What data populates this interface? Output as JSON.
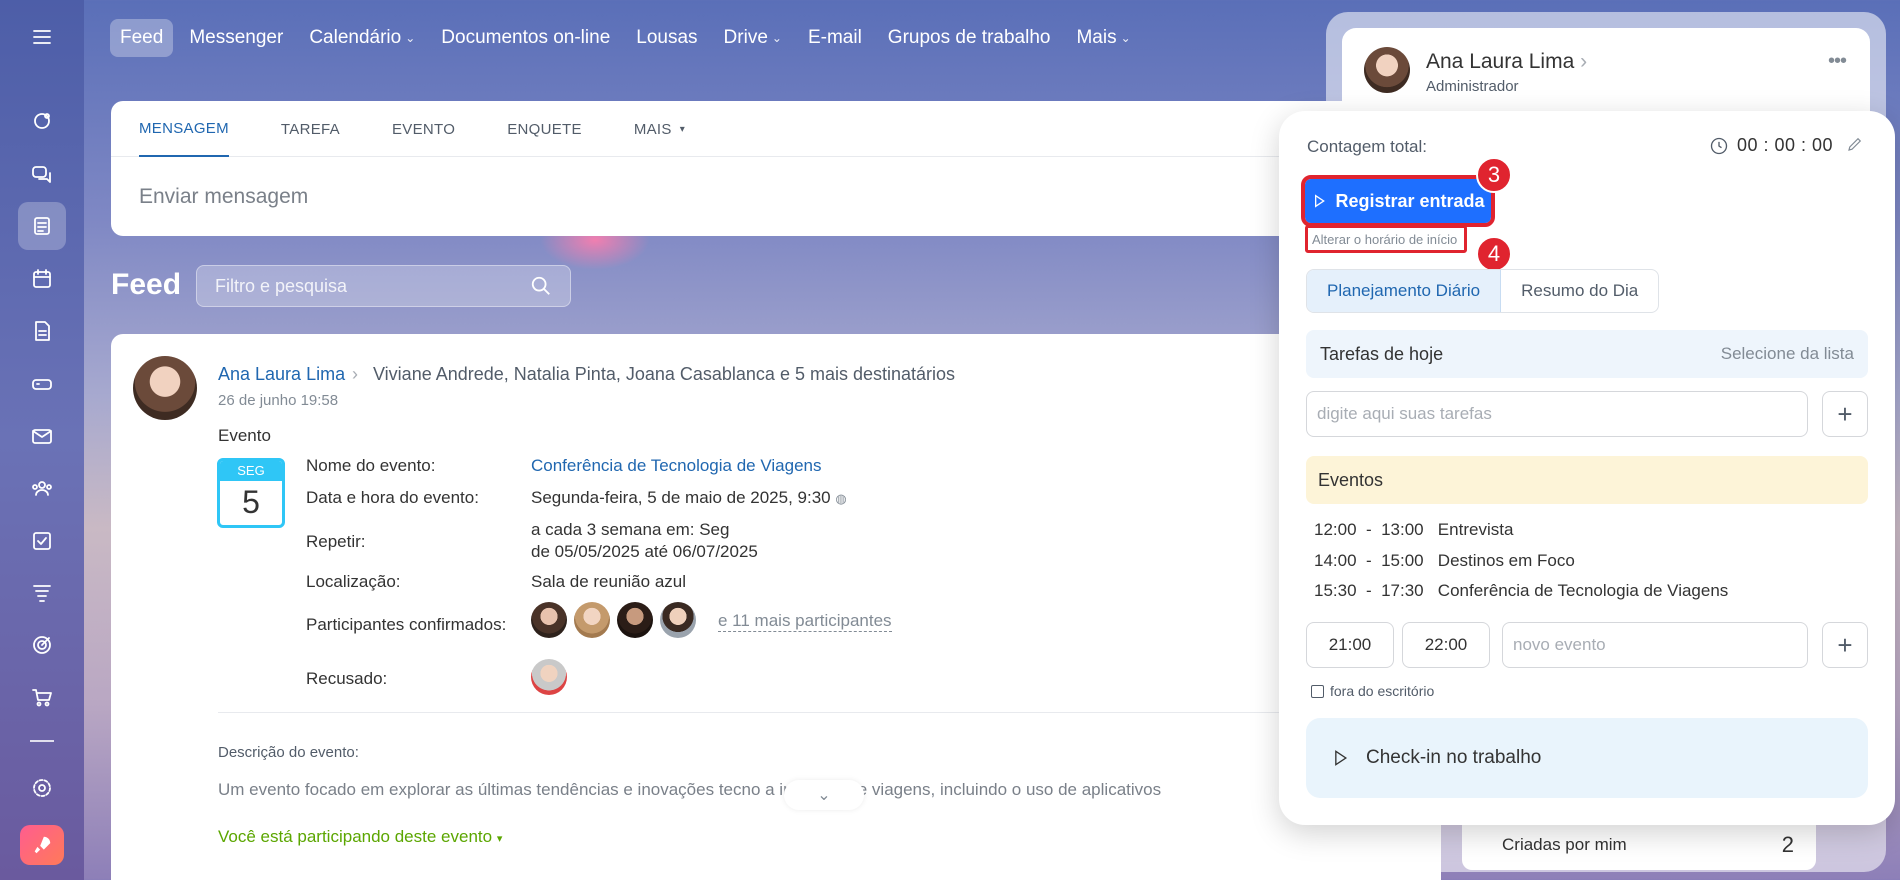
{
  "nav": {
    "items": [
      {
        "label": "Feed",
        "caret": false,
        "active": true
      },
      {
        "label": "Messenger",
        "caret": false
      },
      {
        "label": "Calendário",
        "caret": true
      },
      {
        "label": "Documentos on-line",
        "caret": false
      },
      {
        "label": "Lousas",
        "caret": false
      },
      {
        "label": "Drive",
        "caret": true
      },
      {
        "label": "E-mail",
        "caret": false
      },
      {
        "label": "Grupos de trabalho",
        "caret": false
      },
      {
        "label": "Mais",
        "caret": true
      }
    ]
  },
  "rail": {
    "icons": [
      "menu-icon",
      "activity-icon",
      "chat-icon",
      "feed-icon",
      "calendar-icon",
      "document-icon",
      "drive-icon",
      "mail-icon",
      "groups-icon",
      "tasks-icon",
      "filter-icon",
      "target-icon",
      "cart-icon",
      "settings-icon",
      "rocket-icon"
    ]
  },
  "composer": {
    "tabs": [
      "MENSAGEM",
      "TAREFA",
      "EVENTO",
      "ENQUETE",
      "MAIS"
    ],
    "placeholder": "Enviar mensagem"
  },
  "feed": {
    "title": "Feed",
    "search_placeholder": "Filtro e pesquisa"
  },
  "post": {
    "author": "Ana Laura Lima",
    "recipients": "Viviane Andrede, Natalia Pinta, Joana Casablanca  e 5 mais destinatários",
    "date": "26 de junho 19:58",
    "type": "Evento",
    "cal_month": "SEG",
    "cal_day": "5",
    "labels": {
      "name": "Nome do evento:",
      "datetime": "Data e hora do evento:",
      "repeat": "Repetir:",
      "location": "Localização:",
      "confirmed": "Participantes confirmados:",
      "declined": "Recusado:"
    },
    "values": {
      "name": "Conferência de Tecnologia de Viagens",
      "datetime": "Segunda-feira, 5 de maio de 2025, 9:30",
      "repeat_line1": "a cada 3 semana em: Seg",
      "repeat_line2": "de 05/05/2025 até 06/07/2025",
      "location": "Sala de reunião azul",
      "more_participants": "e 11 mais participantes"
    },
    "desc_label": "Descrição do evento:",
    "desc_text": "Um evento focado em explorar as últimas tendências e inovações tecno          a indústria de viagens, incluindo o uso de aplicativos",
    "participating": "Você está participando deste evento"
  },
  "user_card": {
    "name": "Ana Laura Lima",
    "role": "Administrador",
    "bottom_label": "Criadas por mim",
    "bottom_count": "2"
  },
  "popup": {
    "count_label": "Contagem total:",
    "timer": "00 : 00 : 00",
    "start_button": "Registrar entrada",
    "change_start": "Alterar o horário de início",
    "markers": [
      "3",
      "4"
    ],
    "segments": [
      "Planejamento Diário",
      "Resumo do Dia"
    ],
    "tasks_title": "Tarefas de hoje",
    "tasks_select": "Selecione da lista",
    "task_placeholder": "digite aqui suas tarefas",
    "events_title": "Eventos",
    "events": [
      "12:00  -  13:00   Entrevista",
      "14:00  -  15:00   Destinos em Foco",
      "15:30  -  17:30   Conferência de Tecnologia de Viagens"
    ],
    "time_from": "21:00",
    "time_to": "22:00",
    "new_event_placeholder": "novo evento",
    "out_of_office": "fora do escritório",
    "checkin": "Check-in no trabalho"
  },
  "colors": {
    "accent": "#2067b0",
    "start_button": "#1e6fff",
    "marker": "#e0242f",
    "success": "#5ba600"
  }
}
